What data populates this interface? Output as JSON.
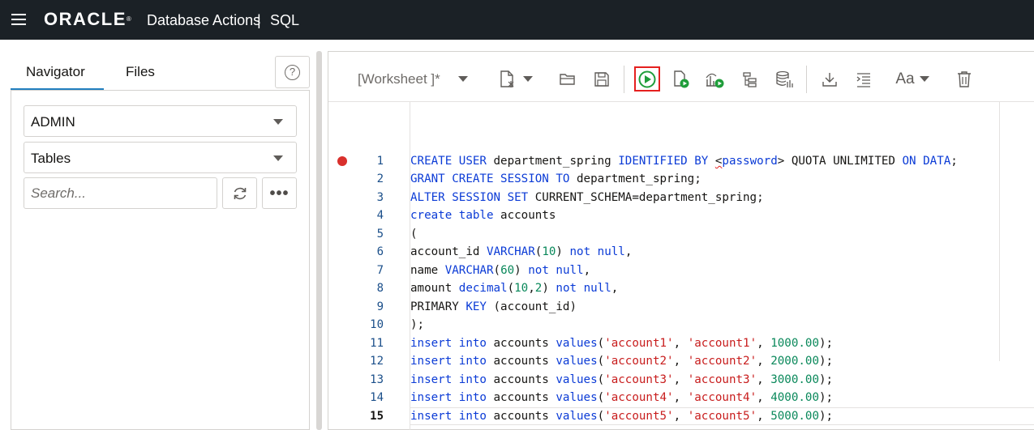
{
  "header": {
    "brand": "ORACLE",
    "app_title": "Database Actions",
    "separator": "|",
    "app_section": "SQL",
    "menu_icon": "hamburger-menu-icon"
  },
  "navigator": {
    "tabs": [
      {
        "label": "Navigator",
        "active": true
      },
      {
        "label": "Files",
        "active": false
      }
    ],
    "help_icon": "help-icon",
    "schema": "ADMIN",
    "object_type": "Tables",
    "search_placeholder": "Search...",
    "refresh_icon": "refresh-icon",
    "more_icon": "more-options-icon",
    "more_glyph": "•••"
  },
  "editor": {
    "worksheet_label": "[Worksheet ]*",
    "toolbar": {
      "new_worksheet_icon": "new-worksheet-icon",
      "open_icon": "folder-open-icon",
      "save_icon": "save-icon",
      "run_statement_icon": "run-statement-icon",
      "run_script_icon": "run-script-icon",
      "autotrace_icon": "autotrace-icon",
      "explain_plan_icon": "explain-plan-icon",
      "sql_history_icon": "sql-history-icon",
      "download_icon": "download-icon",
      "format_icon": "format-icon",
      "font_label": "Aa",
      "clear_icon": "trash-icon"
    },
    "accent_color": "#e5201f",
    "run_color": "#1f9d3a",
    "lines": [
      {
        "n": "1",
        "text": "CREATE USER department_spring IDENTIFIED BY <password> QUOTA UNLIMITED ON DATA;"
      },
      {
        "n": "2",
        "text": "GRANT CREATE SESSION TO department_spring;"
      },
      {
        "n": "3",
        "text": "ALTER SESSION SET CURRENT_SCHEMA=department_spring;"
      },
      {
        "n": "4",
        "text": "create table accounts"
      },
      {
        "n": "5",
        "text": "("
      },
      {
        "n": "6",
        "text": "account_id VARCHAR(10) not null,"
      },
      {
        "n": "7",
        "text": "name VARCHAR(60) not null,"
      },
      {
        "n": "8",
        "text": "amount decimal(10,2) not null,"
      },
      {
        "n": "9",
        "text": "PRIMARY KEY (account_id)"
      },
      {
        "n": "10",
        "text": ");"
      },
      {
        "n": "11",
        "text": "insert into accounts values('account1', 'account1', 1000.00);"
      },
      {
        "n": "12",
        "text": "insert into accounts values('account2', 'account2', 2000.00);"
      },
      {
        "n": "13",
        "text": "insert into accounts values('account3', 'account3', 3000.00);"
      },
      {
        "n": "14",
        "text": "insert into accounts values('account4', 'account4', 4000.00);"
      },
      {
        "n": "15",
        "text": "insert into accounts values('account5', 'account5', 5000.00);"
      }
    ]
  }
}
